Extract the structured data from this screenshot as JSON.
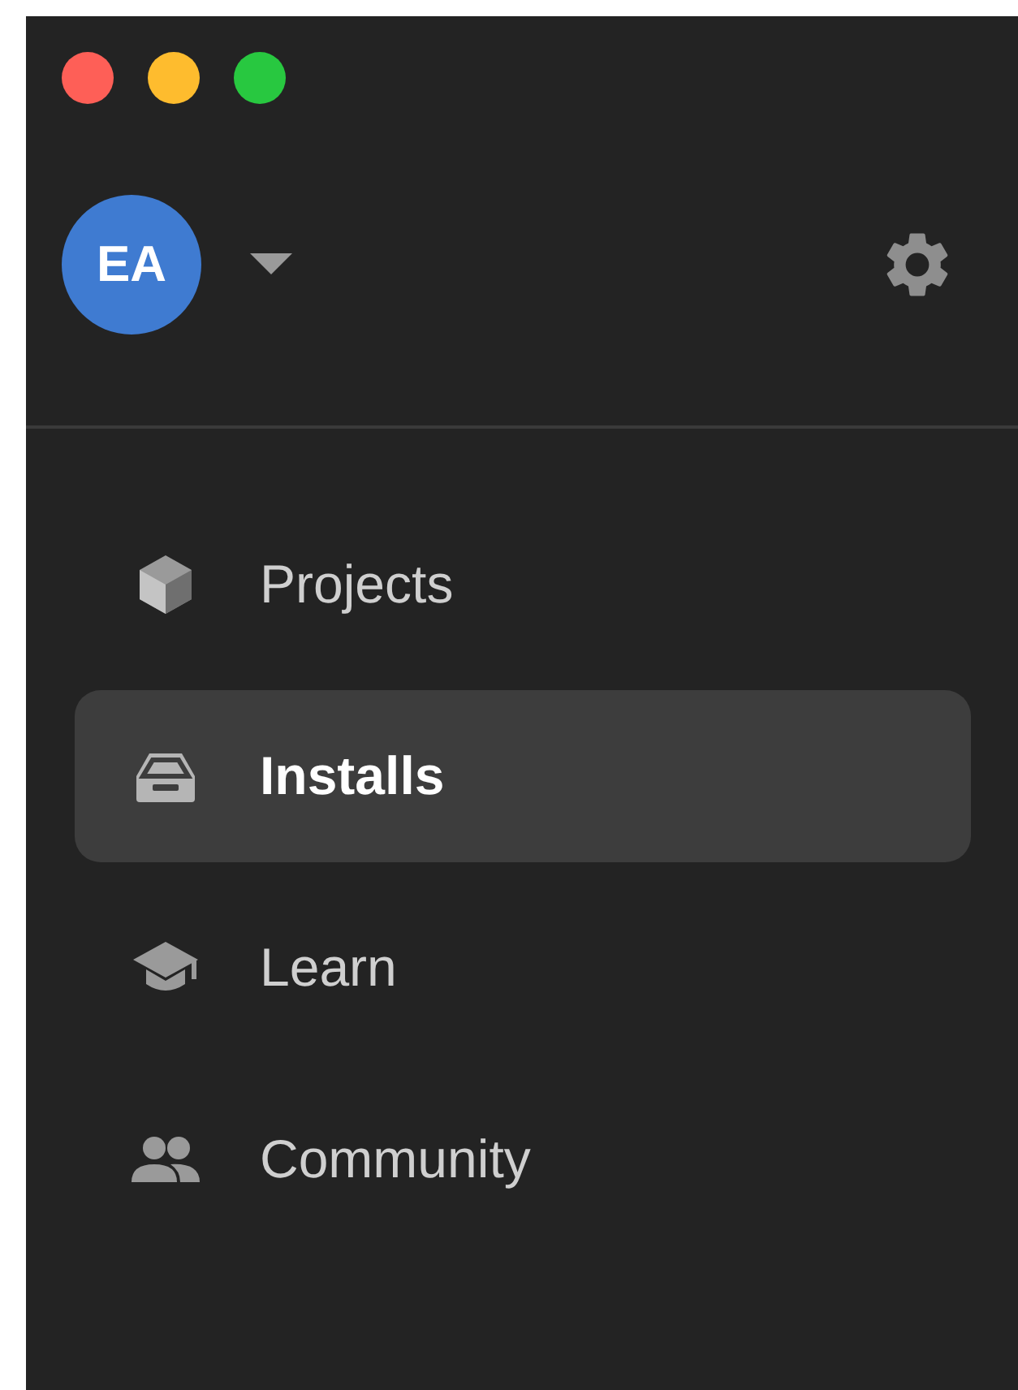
{
  "window_controls": [
    {
      "color": "#fe5f57"
    },
    {
      "color": "#febc2e"
    },
    {
      "color": "#28c840"
    }
  ],
  "account": {
    "initials": "EA"
  },
  "nav": [
    {
      "kind": "cube",
      "label": "Projects",
      "selected": false
    },
    {
      "kind": "drive",
      "label": "Installs",
      "selected": true
    },
    {
      "kind": "cap",
      "label": "Learn",
      "selected": false
    },
    {
      "kind": "people",
      "label": "Community",
      "selected": false
    }
  ]
}
